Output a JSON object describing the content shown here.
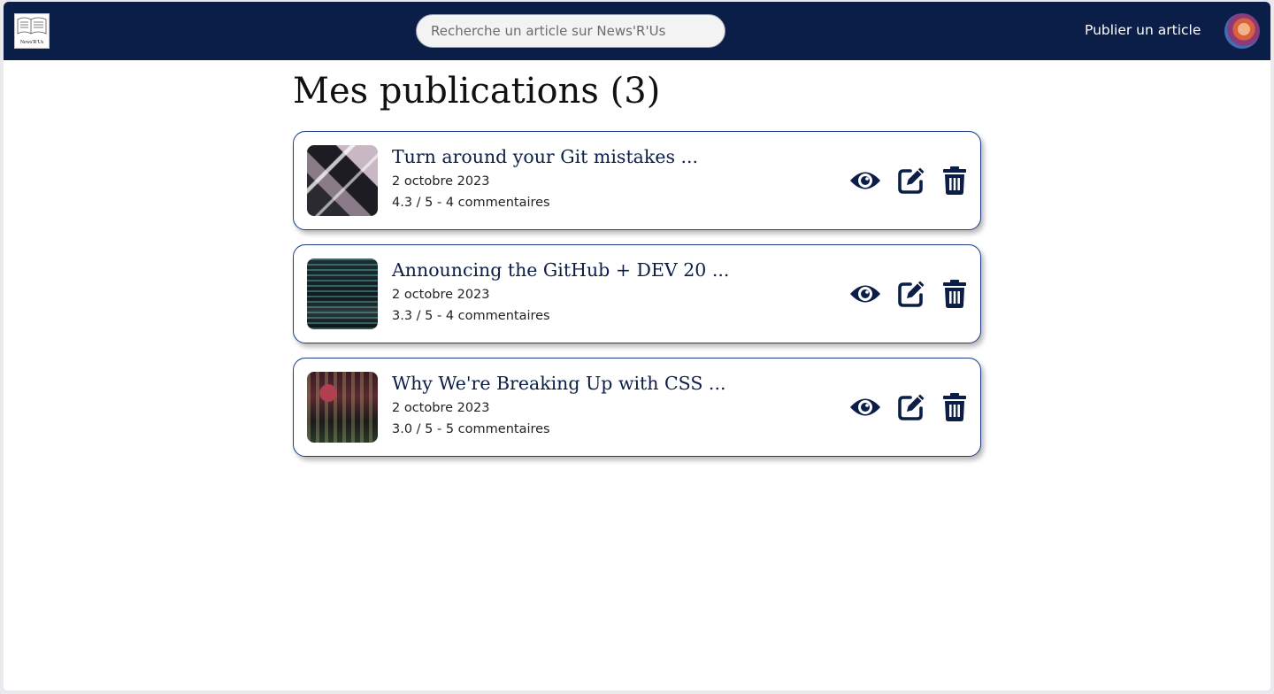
{
  "header": {
    "logo_text": "News'R'Us",
    "search_placeholder": "Recherche un article sur News'R'Us",
    "search_value": "",
    "publish_label": "Publier un article"
  },
  "page": {
    "title": "Mes publications (3)"
  },
  "articles": [
    {
      "title": "Turn around your Git mistakes ...",
      "date": "2 octobre 2023",
      "meta": "4.3 / 5 - 4 commentaires"
    },
    {
      "title": "Announcing the GitHub + DEV 20 ...",
      "date": "2 octobre 2023",
      "meta": "3.3 / 5 - 4 commentaires"
    },
    {
      "title": "Why We're Breaking Up with CSS ...",
      "date": "2 octobre 2023",
      "meta": "3.0 / 5 - 5 commentaires"
    }
  ],
  "icons": {
    "view": "eye-icon",
    "edit": "edit-icon",
    "delete": "trash-icon"
  },
  "colors": {
    "navbar": "#0b1e47",
    "card_border": "#1e3a8a",
    "icon": "#0b1e47"
  }
}
